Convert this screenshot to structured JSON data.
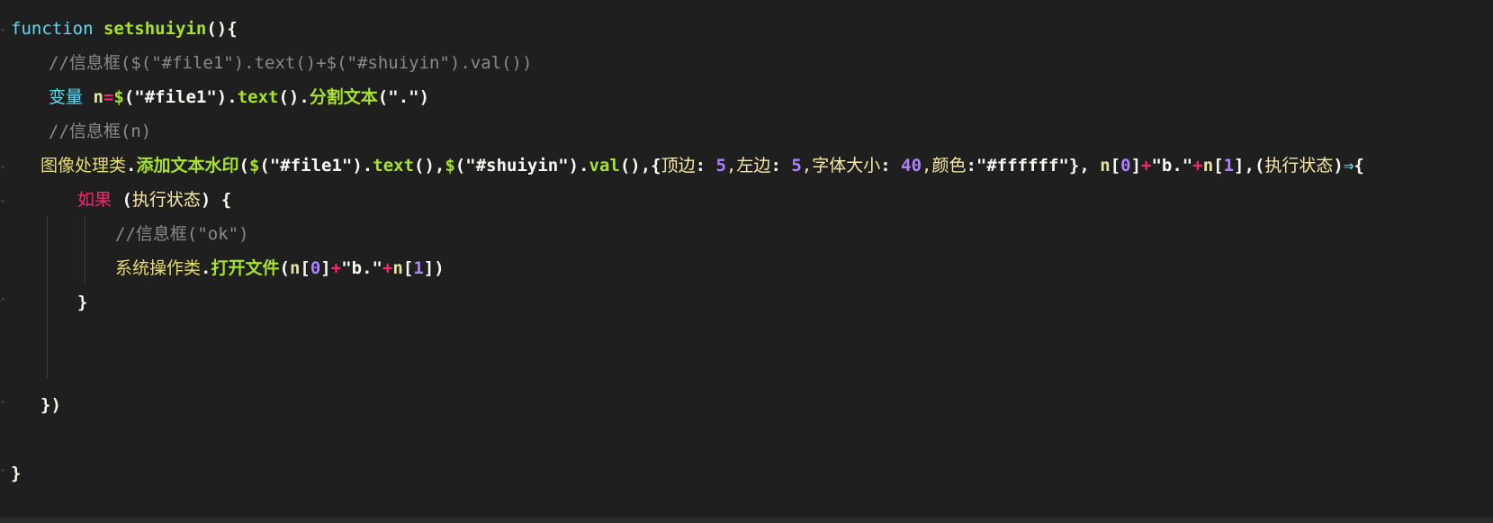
{
  "code": {
    "line1": {
      "kw": "function",
      "name": "setshuiyin",
      "rest": "(){"
    },
    "line2": {
      "comment": "//信息框($(\"#file1\").text()+$(\"#shuiyin\").val())"
    },
    "line3": {
      "kw": "变量",
      "var": "n",
      "eq": "=",
      "dollar": "$",
      "p1": "(",
      "s1": "\"#file1\"",
      "p2": ").",
      "m1": "text",
      "p3": "().",
      "m2": "分割文本",
      "p4": "(",
      "s2": "\".\"",
      "p5": ")"
    },
    "line4": {
      "comment": "//信息框(n)"
    },
    "line5": {
      "cls": "图像处理类",
      "dot": ".",
      "method": "添加文本水印",
      "p1": "(",
      "d1": "$",
      "p2": "(",
      "s1": "\"#file1\"",
      "p3": ").",
      "m1": "text",
      "p4": "(),",
      "d2": "$",
      "p5": "(",
      "s2": "\"#shuiyin\"",
      "p6": ").",
      "m2": "val",
      "p7": "(),{",
      "k1": "顶边",
      "c1": ": ",
      "n1": "5",
      "k2": ",左边",
      "c2": ": ",
      "n2": "5",
      "k3": ",字体大小",
      "c3": ": ",
      "n3": "40",
      "k4": ",颜色",
      "c4": ":",
      "s3": "\"#ffffff\"",
      "p8": "}, ",
      "v1": "n",
      "b1": "[",
      "i1": "0",
      "b2": "]",
      "plus1": "+",
      "s4": "\"b.\"",
      "plus2": "+",
      "v2": "n",
      "b3": "[",
      "i2": "1",
      "b4": "],",
      "p9": "(",
      "arg": "执行状态",
      "p10": ")",
      "arrow": "⇒",
      "p11": "{"
    },
    "line6": {
      "ctl": "如果",
      "p1": " (",
      "arg": "执行状态",
      "p2": ") {"
    },
    "line7": {
      "comment": "//信息框(\"ok\")"
    },
    "line8": {
      "cls": "系统操作类",
      "dot": ".",
      "method": "打开文件",
      "p1": "(",
      "v1": "n",
      "b1": "[",
      "i1": "0",
      "b2": "]",
      "plus1": "+",
      "s1": "\"b.\"",
      "plus2": "+",
      "v2": "n",
      "b3": "[",
      "i2": "1",
      "b4": "])"
    },
    "line9": {
      "text": "}"
    },
    "line12": {
      "text": "})"
    },
    "line14": {
      "text": "}"
    }
  },
  "colors": {
    "background": "#1f1f1f",
    "keyword": "#66d9ef",
    "function": "#a6e22e",
    "number": "#ae81ff",
    "operator": "#f92672",
    "comment": "#8a8a8a"
  }
}
